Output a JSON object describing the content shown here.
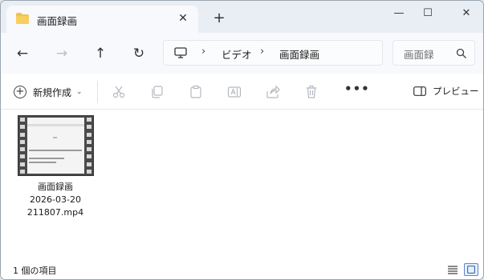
{
  "tab": {
    "title": "画面録画",
    "close": "✕",
    "new_tab": "+"
  },
  "window_controls": {
    "minimize": "—",
    "maximize": "☐",
    "close": "✕"
  },
  "nav": {
    "back": "←",
    "forward": "→",
    "up": "↑",
    "refresh": "↻",
    "breadcrumb": [
      "ビデオ",
      "画面録画"
    ],
    "separator": "›",
    "search_placeholder": "画面録"
  },
  "commandbar": {
    "new_label": "新規作成",
    "new_chevron": "⌄",
    "more": "•••",
    "preview_label": "プレビュー",
    "tools": [
      "cut-icon",
      "copy-icon",
      "paste-icon",
      "rename-icon",
      "share-icon",
      "delete-icon"
    ]
  },
  "files": [
    {
      "name_line1": "画面録画",
      "name_line2": "2026-03-20",
      "name_line3": "211807.mp4"
    }
  ],
  "status": {
    "count": "1 個の項目"
  },
  "colors": {
    "accent": "#5b86c9",
    "folder": "#f2c14e",
    "titlebar": "#e9eef5"
  }
}
